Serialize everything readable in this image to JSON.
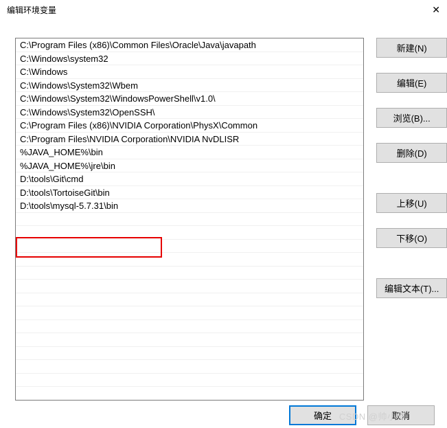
{
  "window": {
    "title": "编辑环境变量",
    "close_glyph": "✕"
  },
  "path_entries": [
    "C:\\Program Files (x86)\\Common Files\\Oracle\\Java\\javapath",
    "C:\\Windows\\system32",
    "C:\\Windows",
    "C:\\Windows\\System32\\Wbem",
    "C:\\Windows\\System32\\WindowsPowerShell\\v1.0\\",
    "C:\\Windows\\System32\\OpenSSH\\",
    "C:\\Program Files (x86)\\NVIDIA Corporation\\PhysX\\Common",
    "C:\\Program Files\\NVIDIA Corporation\\NVIDIA NvDLISR",
    "%JAVA_HOME%\\bin",
    "%JAVA_HOME%\\jre\\bin",
    "D:\\tools\\Git\\cmd",
    "D:\\tools\\TortoiseGit\\bin",
    "D:\\tools\\mysql-5.7.31\\bin"
  ],
  "highlight_index": 12,
  "buttons": {
    "new": "新建(N)",
    "edit": "编辑(E)",
    "browse": "浏览(B)...",
    "delete": "删除(D)",
    "move_up": "上移(U)",
    "move_down": "下移(O)",
    "edit_text": "编辑文本(T)...",
    "ok": "确定",
    "cancel": "取消"
  },
  "watermark": "CSDN @帅小师"
}
